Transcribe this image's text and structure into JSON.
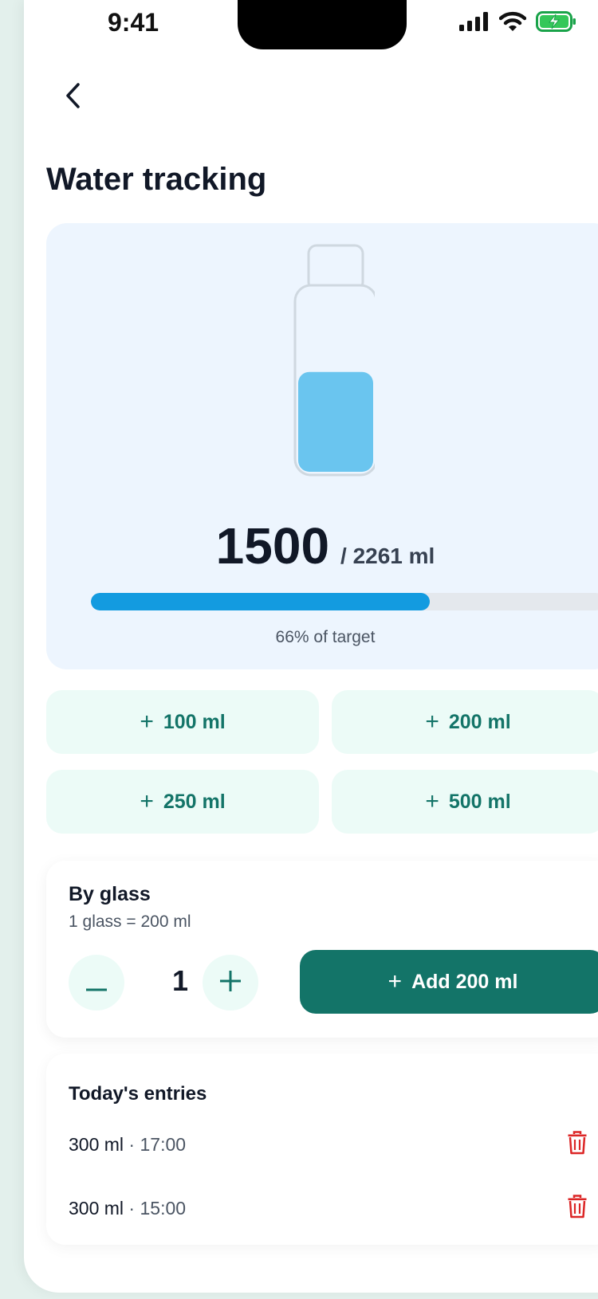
{
  "status_bar": {
    "time": "9:41"
  },
  "header": {
    "title": "Water tracking"
  },
  "progress": {
    "current": "1500",
    "target_label": "/ 2261 ml",
    "fraction": 0.66,
    "caption": "66% of target"
  },
  "quick_add": [
    {
      "label": "100 ml"
    },
    {
      "label": "200 ml"
    },
    {
      "label": "250 ml"
    },
    {
      "label": "500 ml"
    }
  ],
  "by_glass": {
    "title": "By glass",
    "subtitle": "1 glass = 200 ml",
    "count": "1",
    "add_label": "Add 200 ml"
  },
  "entries": {
    "title": "Today's entries",
    "items": [
      {
        "amount": "300 ml",
        "time": "17:00"
      },
      {
        "amount": "300 ml",
        "time": "15:00"
      }
    ]
  },
  "icons": {
    "back": "chevron-left-icon",
    "plus": "plus-icon",
    "minus": "minus-icon",
    "delete": "trash-icon",
    "signal": "cellular-signal-icon",
    "wifi": "wifi-icon",
    "battery": "battery-charging-icon"
  },
  "colors": {
    "accent": "#137468",
    "accent_light": "#ecfbf7",
    "progress_fill": "#139be0",
    "water": "#6ac5ef",
    "delete": "#dc2626"
  }
}
